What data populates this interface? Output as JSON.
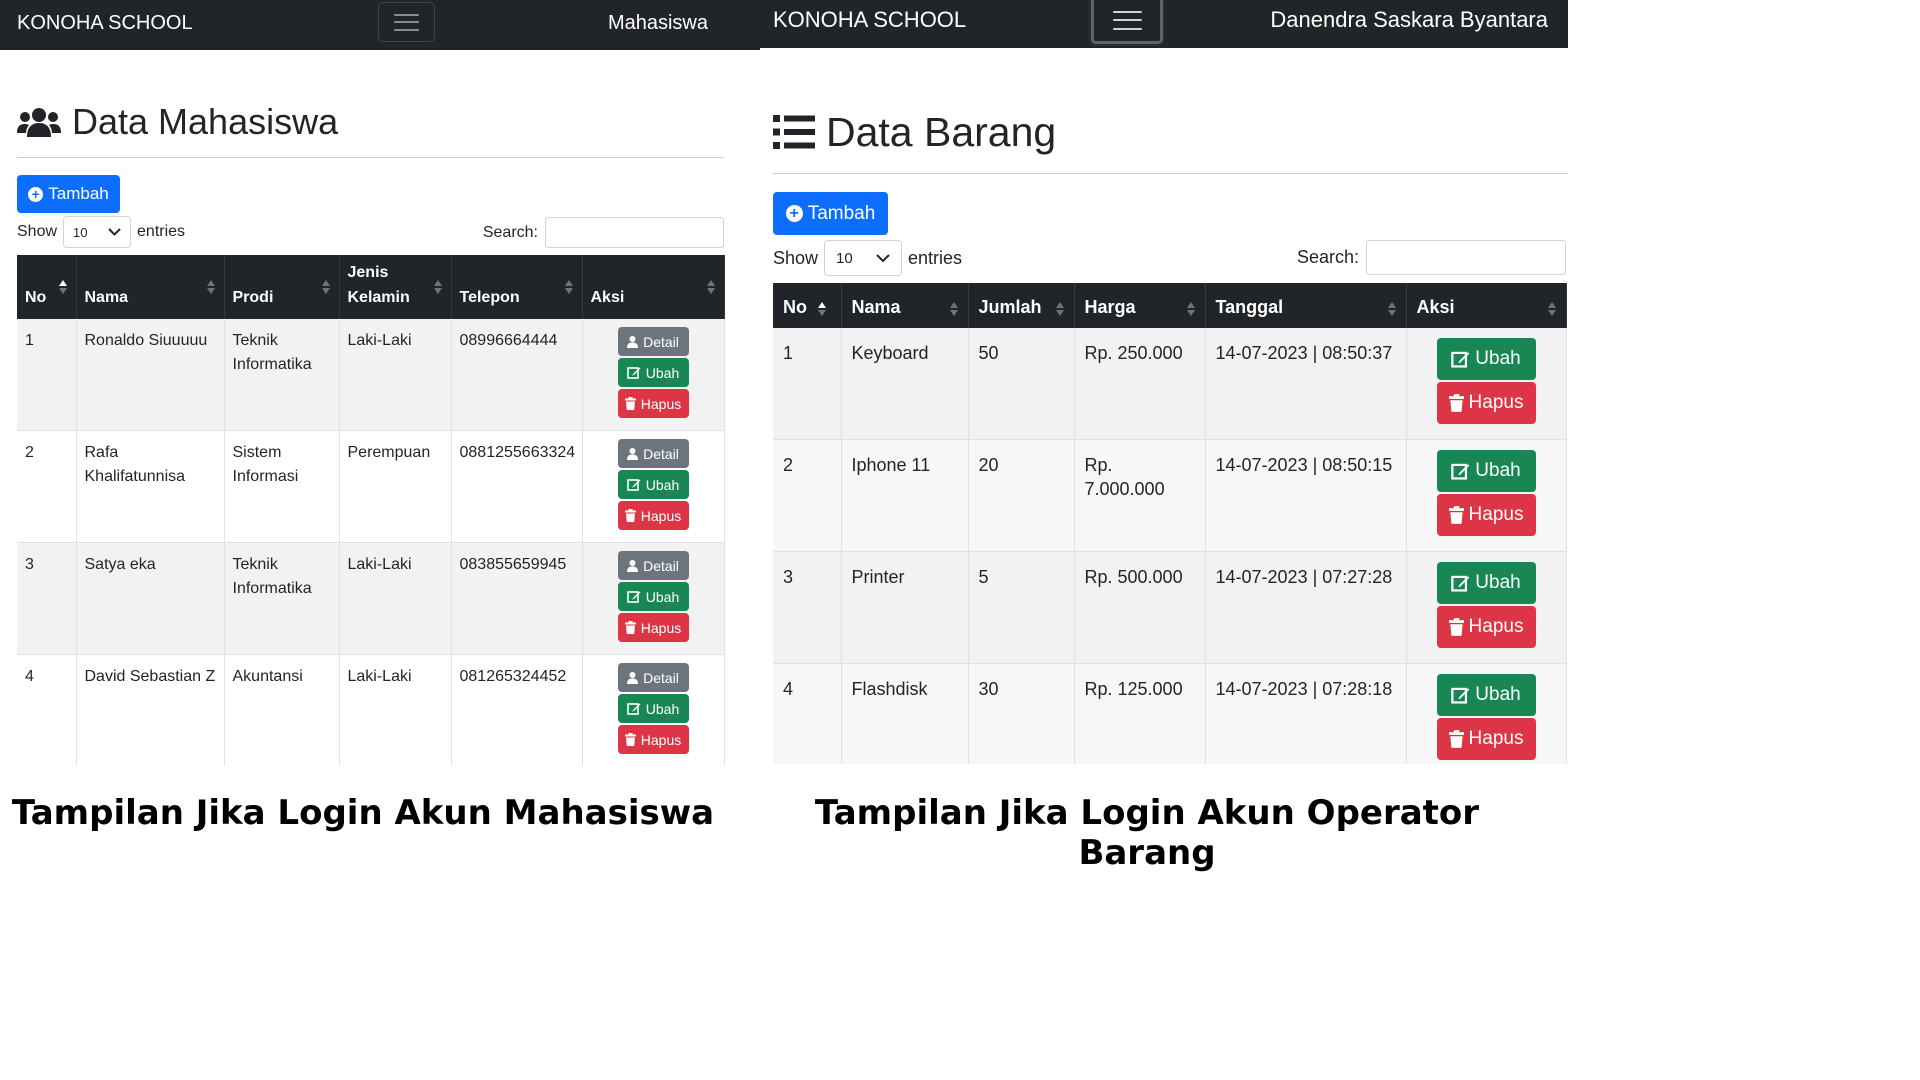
{
  "left": {
    "navbar": {
      "brand": "KONOHA SCHOOL",
      "user": "Mahasiswa"
    },
    "title": "Data Mahasiswa",
    "add_label": "Tambah",
    "show_label": "Show",
    "entries_value": "10",
    "entries_label": "entries",
    "search_label": "Search:",
    "search_value": "",
    "columns": [
      "No",
      "Nama",
      "Prodi",
      "Jenis Kelamin",
      "Telepon",
      "Aksi"
    ],
    "rows": [
      {
        "no": "1",
        "nama": "Ronaldo Siuuuuu",
        "prodi": "Teknik Informatika",
        "jk": "Laki-Laki",
        "telepon": "08996664444"
      },
      {
        "no": "2",
        "nama": "Rafa Khalifatunnisa",
        "prodi": "Sistem Informasi",
        "jk": "Perempuan",
        "telepon": "0881255663324"
      },
      {
        "no": "3",
        "nama": "Satya eka",
        "prodi": "Teknik Informatika",
        "jk": "Laki-Laki",
        "telepon": "083855659945"
      },
      {
        "no": "4",
        "nama": "David Sebastian Z",
        "prodi": "Akuntansi",
        "jk": "Laki-Laki",
        "telepon": "081265324452"
      }
    ],
    "actions": {
      "detail": "Detail",
      "ubah": "Ubah",
      "hapus": "Hapus"
    },
    "caption": "Tampilan Jika Login Akun Mahasiswa"
  },
  "right": {
    "navbar": {
      "brand": "KONOHA SCHOOL",
      "user": "Danendra Saskara Byantara"
    },
    "title": "Data Barang",
    "add_label": "Tambah",
    "show_label": "Show",
    "entries_value": "10",
    "entries_label": "entries",
    "search_label": "Search:",
    "search_value": "",
    "columns": [
      "No",
      "Nama",
      "Jumlah",
      "Harga",
      "Tanggal",
      "Aksi"
    ],
    "rows": [
      {
        "no": "1",
        "nama": "Keyboard",
        "jumlah": "50",
        "harga": "Rp. 250.000",
        "tanggal": "14-07-2023 | 08:50:37"
      },
      {
        "no": "2",
        "nama": "Iphone 11",
        "jumlah": "20",
        "harga": "Rp. 7.000.000",
        "tanggal": "14-07-2023 | 08:50:15"
      },
      {
        "no": "3",
        "nama": "Printer",
        "jumlah": "5",
        "harga": "Rp. 500.000",
        "tanggal": "14-07-2023 | 07:27:28"
      },
      {
        "no": "4",
        "nama": "Flashdisk",
        "jumlah": "30",
        "harga": "Rp. 125.000",
        "tanggal": "14-07-2023 | 07:28:18"
      }
    ],
    "actions": {
      "ubah": "Ubah",
      "hapus": "Hapus"
    },
    "caption": "Tampilan Jika Login Akun Operator Barang"
  },
  "colors": {
    "navbar": "#212529",
    "primary": "#0d6efd",
    "success": "#198754",
    "danger": "#dc3545",
    "secondary": "#6c757d"
  },
  "icons": {
    "users": "users-icon",
    "list": "list-icon",
    "menu": "hamburger-menu-icon",
    "plus": "plus-circle-icon",
    "user": "user-icon",
    "edit": "edit-icon",
    "trash": "trash-icon",
    "sort": "sort-icon"
  }
}
